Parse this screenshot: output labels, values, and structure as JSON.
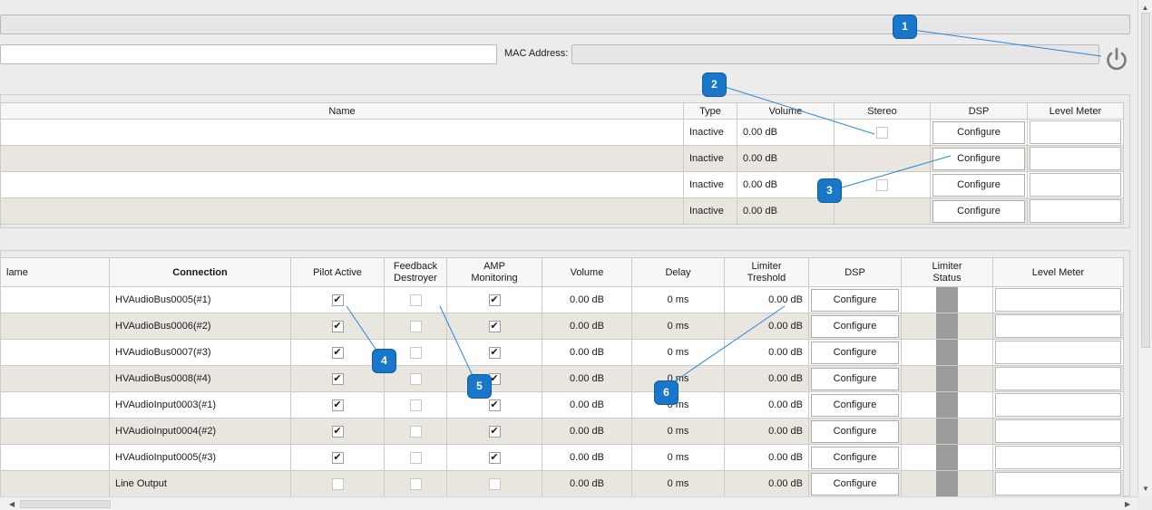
{
  "mac_label": "MAC Address:",
  "callouts": [
    "1",
    "2",
    "3",
    "4",
    "5",
    "6"
  ],
  "top_table": {
    "headers": {
      "name": "Name",
      "type": "Type",
      "volume": "Volume",
      "stereo": "Stereo",
      "dsp": "DSP",
      "level": "Level Meter"
    },
    "rows": [
      {
        "type": "Inactive",
        "volume": "0.00 dB",
        "stereo": false,
        "stereo_visible": true,
        "dsp": "Configure"
      },
      {
        "type": "Inactive",
        "volume": "0.00 dB",
        "stereo": false,
        "stereo_visible": false,
        "dsp": "Configure"
      },
      {
        "type": "Inactive",
        "volume": "0.00 dB",
        "stereo": false,
        "stereo_visible": true,
        "dsp": "Configure"
      },
      {
        "type": "Inactive",
        "volume": "0.00 dB",
        "stereo": false,
        "stereo_visible": false,
        "dsp": "Configure"
      }
    ]
  },
  "bottom_table": {
    "headers": {
      "name": "lame",
      "connection": "Connection",
      "pilot": "Pilot Active",
      "feedback_1": "Feedback",
      "feedback_2": "Destroyer",
      "amp_1": "AMP",
      "amp_2": "Monitoring",
      "volume": "Volume",
      "delay": "Delay",
      "limiter_1": "Limiter",
      "limiter_2": "Treshold",
      "dsp": "DSP",
      "status_1": "Limiter",
      "status_2": "Status",
      "level": "Level Meter"
    },
    "rows": [
      {
        "connection": "HVAudioBus0005(#1)",
        "pilot": true,
        "feedback": false,
        "amp": true,
        "volume": "0.00 dB",
        "delay": "0 ms",
        "limiter": "0.00 dB",
        "dsp": "Configure"
      },
      {
        "connection": "HVAudioBus0006(#2)",
        "pilot": true,
        "feedback": false,
        "amp": true,
        "volume": "0.00 dB",
        "delay": "0 ms",
        "limiter": "0.00 dB",
        "dsp": "Configure"
      },
      {
        "connection": "HVAudioBus0007(#3)",
        "pilot": true,
        "feedback": false,
        "amp": true,
        "volume": "0.00 dB",
        "delay": "0 ms",
        "limiter": "0.00 dB",
        "dsp": "Configure"
      },
      {
        "connection": "HVAudioBus0008(#4)",
        "pilot": true,
        "feedback": false,
        "amp": true,
        "volume": "0.00 dB",
        "delay": "0 ms",
        "limiter": "0.00 dB",
        "dsp": "Configure"
      },
      {
        "connection": "HVAudioInput0003(#1)",
        "pilot": true,
        "feedback": false,
        "amp": true,
        "volume": "0.00 dB",
        "delay": "0 ms",
        "limiter": "0.00 dB",
        "dsp": "Configure"
      },
      {
        "connection": "HVAudioInput0004(#2)",
        "pilot": true,
        "feedback": false,
        "amp": true,
        "volume": "0.00 dB",
        "delay": "0 ms",
        "limiter": "0.00 dB",
        "dsp": "Configure"
      },
      {
        "connection": "HVAudioInput0005(#3)",
        "pilot": true,
        "feedback": false,
        "amp": true,
        "volume": "0.00 dB",
        "delay": "0 ms",
        "limiter": "0.00 dB",
        "dsp": "Configure"
      },
      {
        "connection": "Line Output",
        "pilot": false,
        "feedback": false,
        "amp": false,
        "volume": "0.00 dB",
        "delay": "0 ms",
        "limiter": "0.00 dB",
        "dsp": "Configure"
      }
    ]
  },
  "colors": {
    "callout": "#1877c9",
    "callout_line": "#2a86d6",
    "row_alt": "#e9e6e0",
    "limiter_status": "#9c9c9c"
  },
  "icons": {
    "power": "power-icon"
  }
}
